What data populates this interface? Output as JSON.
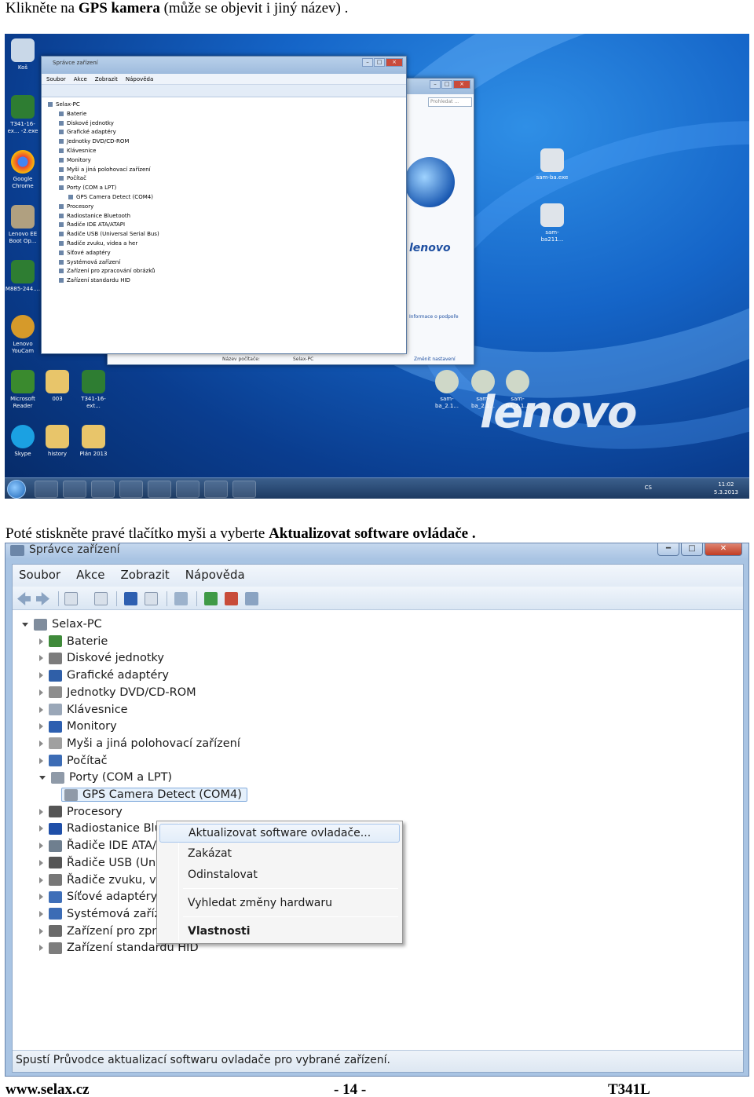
{
  "instructions": {
    "line1_prefix": "Klikněte na",
    "line1_bold": "GPS kamera",
    "line1_suffix": "(může se objevit i jiný název) .",
    "line2_prefix": "Poté stiskněte pravé tlačítko myši a vyberte",
    "line2_bold": "Aktualizovat software ovládače",
    "line2_suffix": "."
  },
  "desktop": {
    "left_icons": [
      "Koš",
      "T341-16-ex... -2.exe",
      "Google Chrome",
      "Lenovo EE Boot Op...",
      "M885-244....",
      "Lenovo YouCam",
      "Microsoft Reader",
      "003",
      "T341-16-ext...",
      "Skype",
      "history",
      "Plán 2013"
    ],
    "right_icons": [
      "sam-ba.exe",
      "sam-ba211...",
      "sam-ba_2.1...",
      "sam-ba_2.1...",
      "sam-ba_2.1..."
    ],
    "brand": "lenovo",
    "mini_window": {
      "title": "Správce zařízení",
      "menu": [
        "Soubor",
        "Akce",
        "Zobrazit",
        "Nápověda"
      ],
      "tree": [
        "Selax-PC",
        "Baterie",
        "Diskové jednotky",
        "Grafické adaptéry",
        "Jednotky DVD/CD-ROM",
        "Klávesnice",
        "Monitory",
        "Myši a jiná polohovací zařízení",
        "Počítač",
        "Porty (COM a LPT)",
        "GPS Camera Detect (COM4)",
        "Procesory",
        "Radiostanice Bluetooth",
        "Řadiče IDE ATA/ATAPI",
        "Řadiče USB (Universal Serial Bus)",
        "Řadiče zvuku, videa a her",
        "Síťové adaptéry",
        "Systémová zařízení",
        "Zařízení pro zpracování obrázků",
        "Zařízení standardu HID"
      ]
    },
    "back_window": {
      "search_placeholder": "Prohledat ...",
      "lenovo_text": "lenovo",
      "support_link": "Informace o podpoře",
      "pc_name_label": "Název počítače:",
      "pc_name_value": "Selax-PC",
      "change_settings": "Změnit nastavení"
    },
    "taskbar": {
      "lang": "CS",
      "time": "11:02",
      "date": "5.3.2013"
    }
  },
  "device_manager": {
    "title": "Správce zařízení",
    "menu": [
      "Soubor",
      "Akce",
      "Zobrazit",
      "Nápověda"
    ],
    "root": "Selax-PC",
    "nodes": [
      {
        "label": "Baterie",
        "color": "#3f8a3a"
      },
      {
        "label": "Diskové jednotky",
        "color": "#7c7c7c"
      },
      {
        "label": "Grafické adaptéry",
        "color": "#2f5fa8"
      },
      {
        "label": "Jednotky DVD/CD-ROM",
        "color": "#8d8d8d"
      },
      {
        "label": "Klávesnice",
        "color": "#9aa7b8"
      },
      {
        "label": "Monitory",
        "color": "#2d5fb0"
      },
      {
        "label": "Myši a jiná polohovací zařízení",
        "color": "#a0a0a0"
      },
      {
        "label": "Počítač",
        "color": "#3c6cb5"
      },
      {
        "label": "Porty (COM a LPT)",
        "color": "#8f9aa8"
      },
      {
        "label": "GPS Camera Detect (COM4)",
        "color": "#8f9aa8"
      },
      {
        "label": "Procesory",
        "color": "#555555"
      },
      {
        "label": "Radiostanice Blu",
        "color": "#1f4fa8"
      },
      {
        "label": "Řadiče IDE ATA/",
        "color": "#6f7f8f"
      },
      {
        "label": "Řadiče USB (Uni",
        "color": "#555555"
      },
      {
        "label": "Řadiče zvuku, vi",
        "color": "#777777"
      },
      {
        "label": "Síťové adaptéry",
        "color": "#3f6fb8"
      },
      {
        "label": "Systémová zaříz",
        "color": "#3c6cb5"
      },
      {
        "label": "Zařízení pro zpracování obrázků",
        "color": "#6a6a6a"
      },
      {
        "label": "Zařízení standardu HID",
        "color": "#7d7d7d"
      }
    ],
    "context_menu": {
      "update": "Aktualizovat software ovladače...",
      "disable": "Zakázat",
      "uninstall": "Odinstalovat",
      "scan": "Vyhledat změny hardwaru",
      "properties": "Vlastnosti"
    },
    "status": "Spustí Průvodce aktualizací softwaru ovladače pro vybrané zařízení."
  },
  "footer": {
    "website": "www.selax.cz",
    "page": "- 14 -",
    "model": "T341L"
  }
}
